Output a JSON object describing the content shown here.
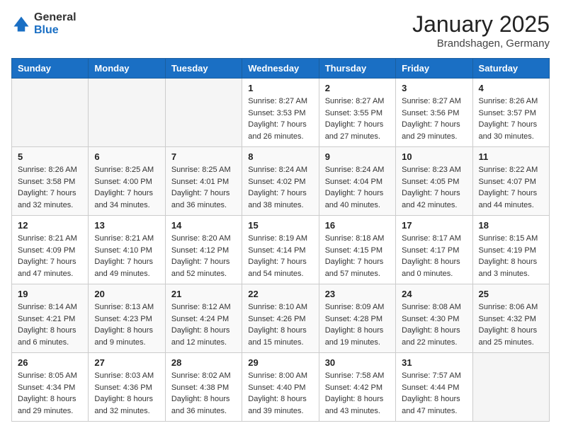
{
  "header": {
    "logo_general": "General",
    "logo_blue": "Blue",
    "month_title": "January 2025",
    "location": "Brandshagen, Germany"
  },
  "days_of_week": [
    "Sunday",
    "Monday",
    "Tuesday",
    "Wednesday",
    "Thursday",
    "Friday",
    "Saturday"
  ],
  "weeks": [
    [
      {
        "day": "",
        "info": ""
      },
      {
        "day": "",
        "info": ""
      },
      {
        "day": "",
        "info": ""
      },
      {
        "day": "1",
        "info": "Sunrise: 8:27 AM\nSunset: 3:53 PM\nDaylight: 7 hours and 26 minutes."
      },
      {
        "day": "2",
        "info": "Sunrise: 8:27 AM\nSunset: 3:55 PM\nDaylight: 7 hours and 27 minutes."
      },
      {
        "day": "3",
        "info": "Sunrise: 8:27 AM\nSunset: 3:56 PM\nDaylight: 7 hours and 29 minutes."
      },
      {
        "day": "4",
        "info": "Sunrise: 8:26 AM\nSunset: 3:57 PM\nDaylight: 7 hours and 30 minutes."
      }
    ],
    [
      {
        "day": "5",
        "info": "Sunrise: 8:26 AM\nSunset: 3:58 PM\nDaylight: 7 hours and 32 minutes."
      },
      {
        "day": "6",
        "info": "Sunrise: 8:25 AM\nSunset: 4:00 PM\nDaylight: 7 hours and 34 minutes."
      },
      {
        "day": "7",
        "info": "Sunrise: 8:25 AM\nSunset: 4:01 PM\nDaylight: 7 hours and 36 minutes."
      },
      {
        "day": "8",
        "info": "Sunrise: 8:24 AM\nSunset: 4:02 PM\nDaylight: 7 hours and 38 minutes."
      },
      {
        "day": "9",
        "info": "Sunrise: 8:24 AM\nSunset: 4:04 PM\nDaylight: 7 hours and 40 minutes."
      },
      {
        "day": "10",
        "info": "Sunrise: 8:23 AM\nSunset: 4:05 PM\nDaylight: 7 hours and 42 minutes."
      },
      {
        "day": "11",
        "info": "Sunrise: 8:22 AM\nSunset: 4:07 PM\nDaylight: 7 hours and 44 minutes."
      }
    ],
    [
      {
        "day": "12",
        "info": "Sunrise: 8:21 AM\nSunset: 4:09 PM\nDaylight: 7 hours and 47 minutes."
      },
      {
        "day": "13",
        "info": "Sunrise: 8:21 AM\nSunset: 4:10 PM\nDaylight: 7 hours and 49 minutes."
      },
      {
        "day": "14",
        "info": "Sunrise: 8:20 AM\nSunset: 4:12 PM\nDaylight: 7 hours and 52 minutes."
      },
      {
        "day": "15",
        "info": "Sunrise: 8:19 AM\nSunset: 4:14 PM\nDaylight: 7 hours and 54 minutes."
      },
      {
        "day": "16",
        "info": "Sunrise: 8:18 AM\nSunset: 4:15 PM\nDaylight: 7 hours and 57 minutes."
      },
      {
        "day": "17",
        "info": "Sunrise: 8:17 AM\nSunset: 4:17 PM\nDaylight: 8 hours and 0 minutes."
      },
      {
        "day": "18",
        "info": "Sunrise: 8:15 AM\nSunset: 4:19 PM\nDaylight: 8 hours and 3 minutes."
      }
    ],
    [
      {
        "day": "19",
        "info": "Sunrise: 8:14 AM\nSunset: 4:21 PM\nDaylight: 8 hours and 6 minutes."
      },
      {
        "day": "20",
        "info": "Sunrise: 8:13 AM\nSunset: 4:23 PM\nDaylight: 8 hours and 9 minutes."
      },
      {
        "day": "21",
        "info": "Sunrise: 8:12 AM\nSunset: 4:24 PM\nDaylight: 8 hours and 12 minutes."
      },
      {
        "day": "22",
        "info": "Sunrise: 8:10 AM\nSunset: 4:26 PM\nDaylight: 8 hours and 15 minutes."
      },
      {
        "day": "23",
        "info": "Sunrise: 8:09 AM\nSunset: 4:28 PM\nDaylight: 8 hours and 19 minutes."
      },
      {
        "day": "24",
        "info": "Sunrise: 8:08 AM\nSunset: 4:30 PM\nDaylight: 8 hours and 22 minutes."
      },
      {
        "day": "25",
        "info": "Sunrise: 8:06 AM\nSunset: 4:32 PM\nDaylight: 8 hours and 25 minutes."
      }
    ],
    [
      {
        "day": "26",
        "info": "Sunrise: 8:05 AM\nSunset: 4:34 PM\nDaylight: 8 hours and 29 minutes."
      },
      {
        "day": "27",
        "info": "Sunrise: 8:03 AM\nSunset: 4:36 PM\nDaylight: 8 hours and 32 minutes."
      },
      {
        "day": "28",
        "info": "Sunrise: 8:02 AM\nSunset: 4:38 PM\nDaylight: 8 hours and 36 minutes."
      },
      {
        "day": "29",
        "info": "Sunrise: 8:00 AM\nSunset: 4:40 PM\nDaylight: 8 hours and 39 minutes."
      },
      {
        "day": "30",
        "info": "Sunrise: 7:58 AM\nSunset: 4:42 PM\nDaylight: 8 hours and 43 minutes."
      },
      {
        "day": "31",
        "info": "Sunrise: 7:57 AM\nSunset: 4:44 PM\nDaylight: 8 hours and 47 minutes."
      },
      {
        "day": "",
        "info": ""
      }
    ]
  ]
}
